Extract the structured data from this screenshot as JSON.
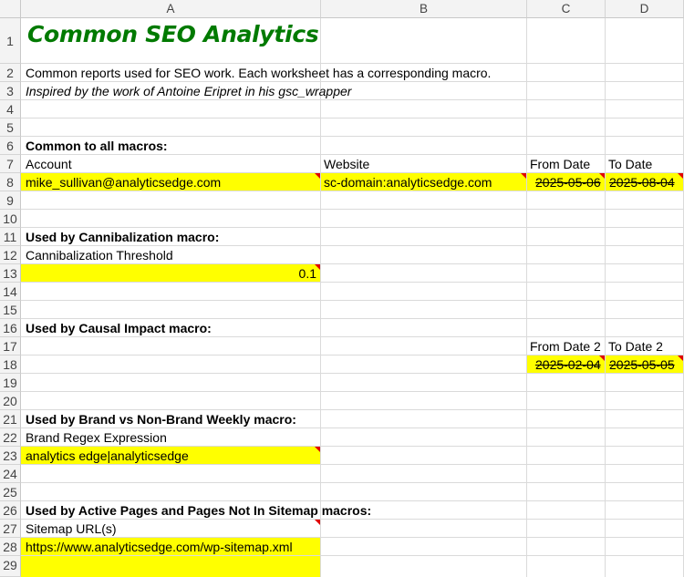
{
  "columns": [
    "A",
    "B",
    "C",
    "D"
  ],
  "rows": [
    "1",
    "2",
    "3",
    "4",
    "5",
    "6",
    "7",
    "8",
    "9",
    "10",
    "11",
    "12",
    "13",
    "14",
    "15",
    "16",
    "17",
    "18",
    "19",
    "20",
    "21",
    "22",
    "23",
    "24",
    "25",
    "26",
    "27",
    "28",
    "29"
  ],
  "title": "Common SEO Analytics",
  "description": "Common reports used for SEO work. Each worksheet has a corresponding macro.",
  "inspired": "Inspired by the work of Antoine Eripret in his gsc_wrapper",
  "common": {
    "header": "Common to all macros:",
    "account_label": "Account",
    "website_label": "Website",
    "from_label": "From Date",
    "to_label": "To Date",
    "account": "mike_sullivan@analyticsedge.com",
    "website": "sc-domain:analyticsedge.com",
    "from_date": "2025-05-06",
    "to_date": "2025-08-04"
  },
  "cannibalization": {
    "header": "Used by Cannibalization macro:",
    "label": "Cannibalization Threshold",
    "value": "0.1"
  },
  "causal": {
    "header": "Used by Causal Impact macro:",
    "from_label": "From Date 2",
    "to_label": "To Date 2",
    "from_date": "2025-02-04",
    "to_date": "2025-05-05"
  },
  "brand": {
    "header": "Used by Brand vs Non-Brand Weekly macro:",
    "label": "Brand Regex Expression",
    "value": "analytics edge|analyticsedge"
  },
  "sitemap": {
    "header": "Used by Active Pages and Pages Not In Sitemap macros:",
    "label": "Sitemap URL(s)",
    "value": "https://www.analyticsedge.com/wp-sitemap.xml"
  },
  "colors": {
    "highlight": "#ffff00",
    "title": "#007a00",
    "comment_marker": "#e00000"
  }
}
